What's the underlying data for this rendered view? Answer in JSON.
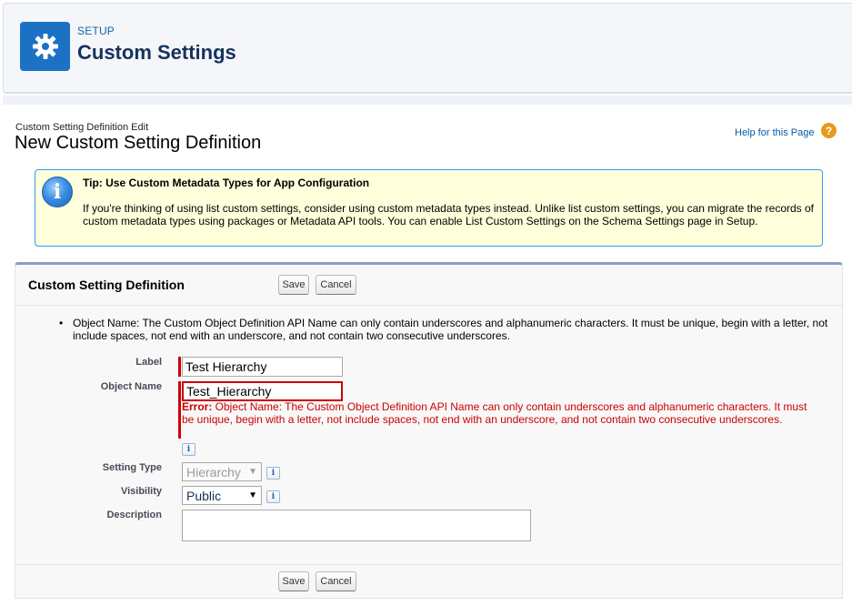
{
  "header": {
    "breadcrumb": "SETUP",
    "title": "Custom Settings",
    "icon": "gear-icon"
  },
  "page": {
    "subtitle": "Custom Setting Definition Edit",
    "title": "New Custom Setting Definition",
    "help_link": "Help for this Page",
    "help_icon": "?"
  },
  "tip": {
    "icon": "i",
    "title": "Tip: Use Custom Metadata Types for App Configuration",
    "text": "If you're thinking of using list custom settings, consider using custom metadata types instead. Unlike list custom settings, you can migrate the records of custom metadata types using packages or Metadata API tools. You can enable List Custom Settings on the Schema Settings page in Setup."
  },
  "panel": {
    "title": "Custom Setting Definition",
    "save_label": "Save",
    "cancel_label": "Cancel",
    "notice": "Object Name: The Custom Object Definition API Name can only contain underscores and alphanumeric characters. It must be unique, begin with a letter, not include spaces, not end with an underscore, and not contain two consecutive underscores."
  },
  "form": {
    "label": {
      "label": "Label",
      "value": "Test Hierarchy"
    },
    "object_name": {
      "label": "Object Name",
      "value": "Test_Hierarchy",
      "error_prefix": "Error:",
      "error_text": " Object Name: The Custom Object Definition API Name can only contain underscores and alphanumeric characters. It must be unique, begin with a letter, not include spaces, not end with an underscore, and not contain two consecutive underscores."
    },
    "setting_type": {
      "label": "Setting Type",
      "value": "Hierarchy"
    },
    "visibility": {
      "label": "Visibility",
      "value": "Public"
    },
    "description": {
      "label": "Description",
      "value": ""
    },
    "info_glyph": "i"
  },
  "colors": {
    "brand": "#1b72c5",
    "error": "#cc0000",
    "tip_bg": "#ffffdc"
  }
}
